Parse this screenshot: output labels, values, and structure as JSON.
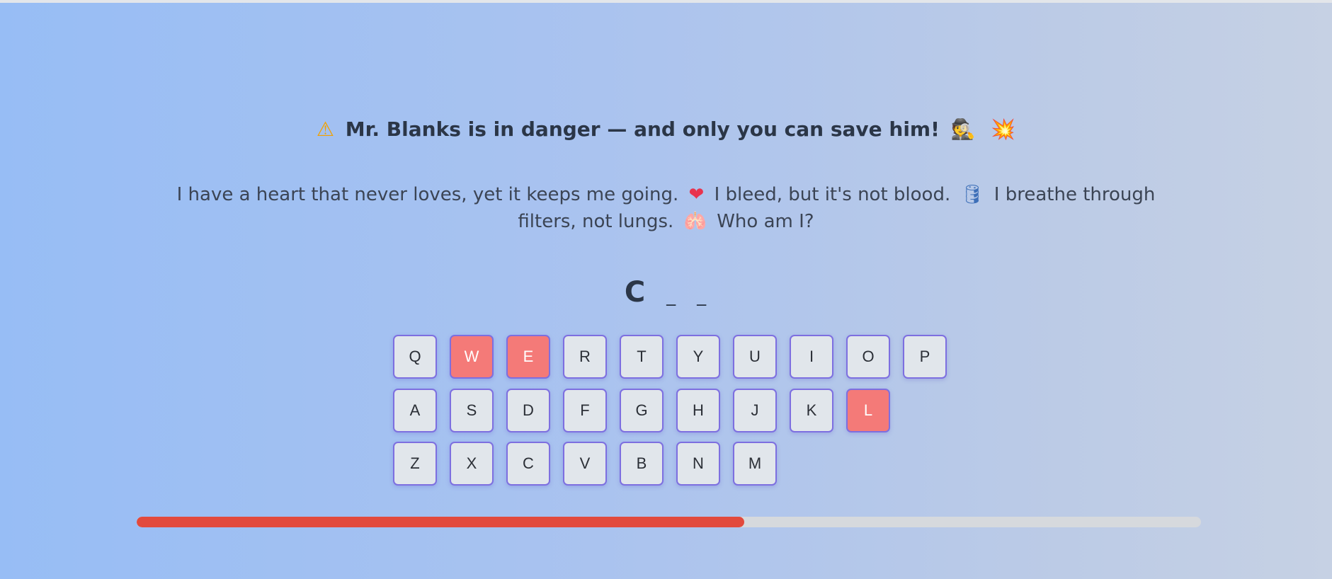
{
  "headline": {
    "icon_left": "⚠",
    "text": "Mr. Blanks is in danger — and only you can save him!",
    "icon_right_1": "🕵",
    "icon_right_2": "💥"
  },
  "riddle": {
    "part1": "I have a heart that never loves, yet it keeps me going.",
    "emoji1": "❤",
    "part2": "I bleed, but it's not blood.",
    "emoji2": "🛢",
    "part3": "I breathe through filters, not lungs.",
    "emoji3": "🫁",
    "part4": "Who am I?"
  },
  "word": [
    "C",
    "_",
    "_"
  ],
  "keyboard": {
    "rows": [
      [
        "Q",
        "W",
        "E",
        "R",
        "T",
        "Y",
        "U",
        "I",
        "O",
        "P"
      ],
      [
        "A",
        "S",
        "D",
        "F",
        "G",
        "H",
        "J",
        "K",
        "L"
      ],
      [
        "Z",
        "X",
        "C",
        "V",
        "B",
        "N",
        "M"
      ]
    ],
    "wrong_letters": [
      "W",
      "E",
      "L"
    ]
  },
  "progress": {
    "fraction": 0.571
  },
  "colors": {
    "key_default": "#e1e6eb",
    "key_wrong": "#f47a78",
    "key_border": "#7d6fe0",
    "progress_fill": "#e24a3d",
    "progress_track": "#d6d9dd"
  }
}
